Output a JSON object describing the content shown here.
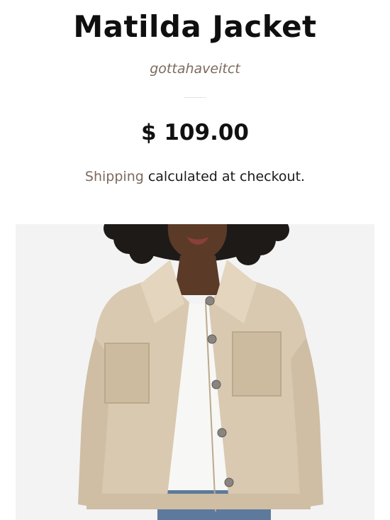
{
  "product": {
    "title": "Matilda Jacket",
    "vendor": "gottahaveitct",
    "price": "$ 109.00",
    "shipping_link": "Shipping",
    "shipping_text": " calculated at checkout."
  },
  "colors": {
    "vendor": "#7d6a5c",
    "jacket": "#d9c9b0",
    "image_background": "#f3f3f3"
  }
}
